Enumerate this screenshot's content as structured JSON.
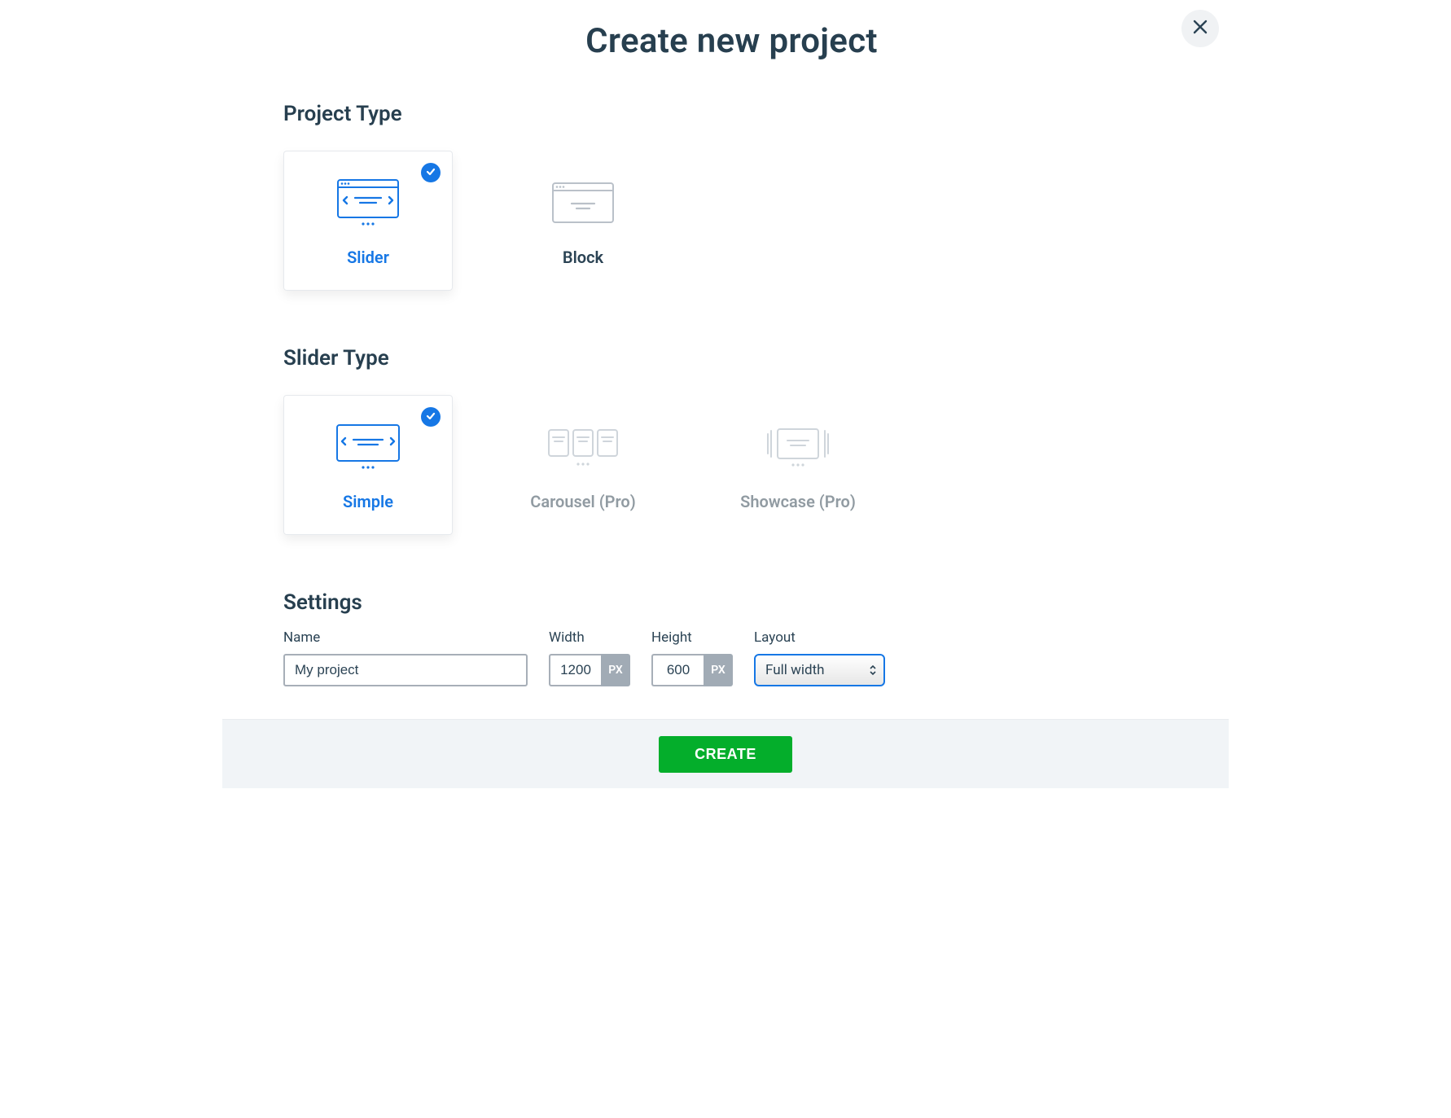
{
  "title": "Create new project",
  "sections": {
    "project_type": {
      "heading": "Project Type",
      "options": [
        {
          "label": "Slider",
          "selected": true
        },
        {
          "label": "Block",
          "selected": false
        }
      ]
    },
    "slider_type": {
      "heading": "Slider Type",
      "options": [
        {
          "label": "Simple",
          "selected": true,
          "disabled": false
        },
        {
          "label": "Carousel (Pro)",
          "selected": false,
          "disabled": true
        },
        {
          "label": "Showcase (Pro)",
          "selected": false,
          "disabled": true
        }
      ]
    },
    "settings": {
      "heading": "Settings",
      "name": {
        "label": "Name",
        "value": "My project"
      },
      "width": {
        "label": "Width",
        "value": "1200",
        "unit": "PX"
      },
      "height": {
        "label": "Height",
        "value": "600",
        "unit": "PX"
      },
      "layout": {
        "label": "Layout",
        "value": "Full width"
      }
    }
  },
  "footer": {
    "create_label": "CREATE"
  },
  "colors": {
    "accent_blue": "#1677e5",
    "accent_green": "#04ae2b",
    "text_dark": "#273f4f",
    "text_muted": "#919ba2",
    "icon_muted": "#bac1c9"
  }
}
